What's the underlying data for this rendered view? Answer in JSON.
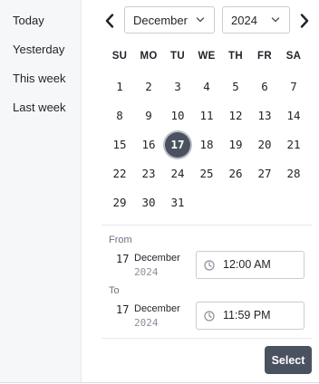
{
  "presets": [
    "Today",
    "Yesterday",
    "This week",
    "Last week"
  ],
  "calendar": {
    "month": "December",
    "year": "2024",
    "weekdays": [
      "SU",
      "MO",
      "TU",
      "WE",
      "TH",
      "FR",
      "SA"
    ],
    "weeks": [
      [
        "1",
        "2",
        "3",
        "4",
        "5",
        "6",
        "7"
      ],
      [
        "8",
        "9",
        "10",
        "11",
        "12",
        "13",
        "14"
      ],
      [
        "15",
        "16",
        "17",
        "18",
        "19",
        "20",
        "21"
      ],
      [
        "22",
        "23",
        "24",
        "25",
        "26",
        "27",
        "28"
      ],
      [
        "29",
        "30",
        "31",
        "",
        "",
        "",
        ""
      ]
    ],
    "selected_day": "17"
  },
  "range": {
    "from": {
      "label": "From",
      "day": "17",
      "month": "December",
      "year": "2024",
      "time": "12:00 AM"
    },
    "to": {
      "label": "To",
      "day": "17",
      "month": "December",
      "year": "2024",
      "time": "11:59 PM"
    }
  },
  "actions": {
    "select_label": "Select"
  },
  "icons": {
    "prev": "chevron-left-icon",
    "next": "chevron-right-icon",
    "dropdown": "chevron-down-icon",
    "time": "clock-icon"
  },
  "colors": {
    "accent": "#4a5260",
    "sidebar_bg": "#f6f7f9",
    "border": "#c8ccd2"
  }
}
